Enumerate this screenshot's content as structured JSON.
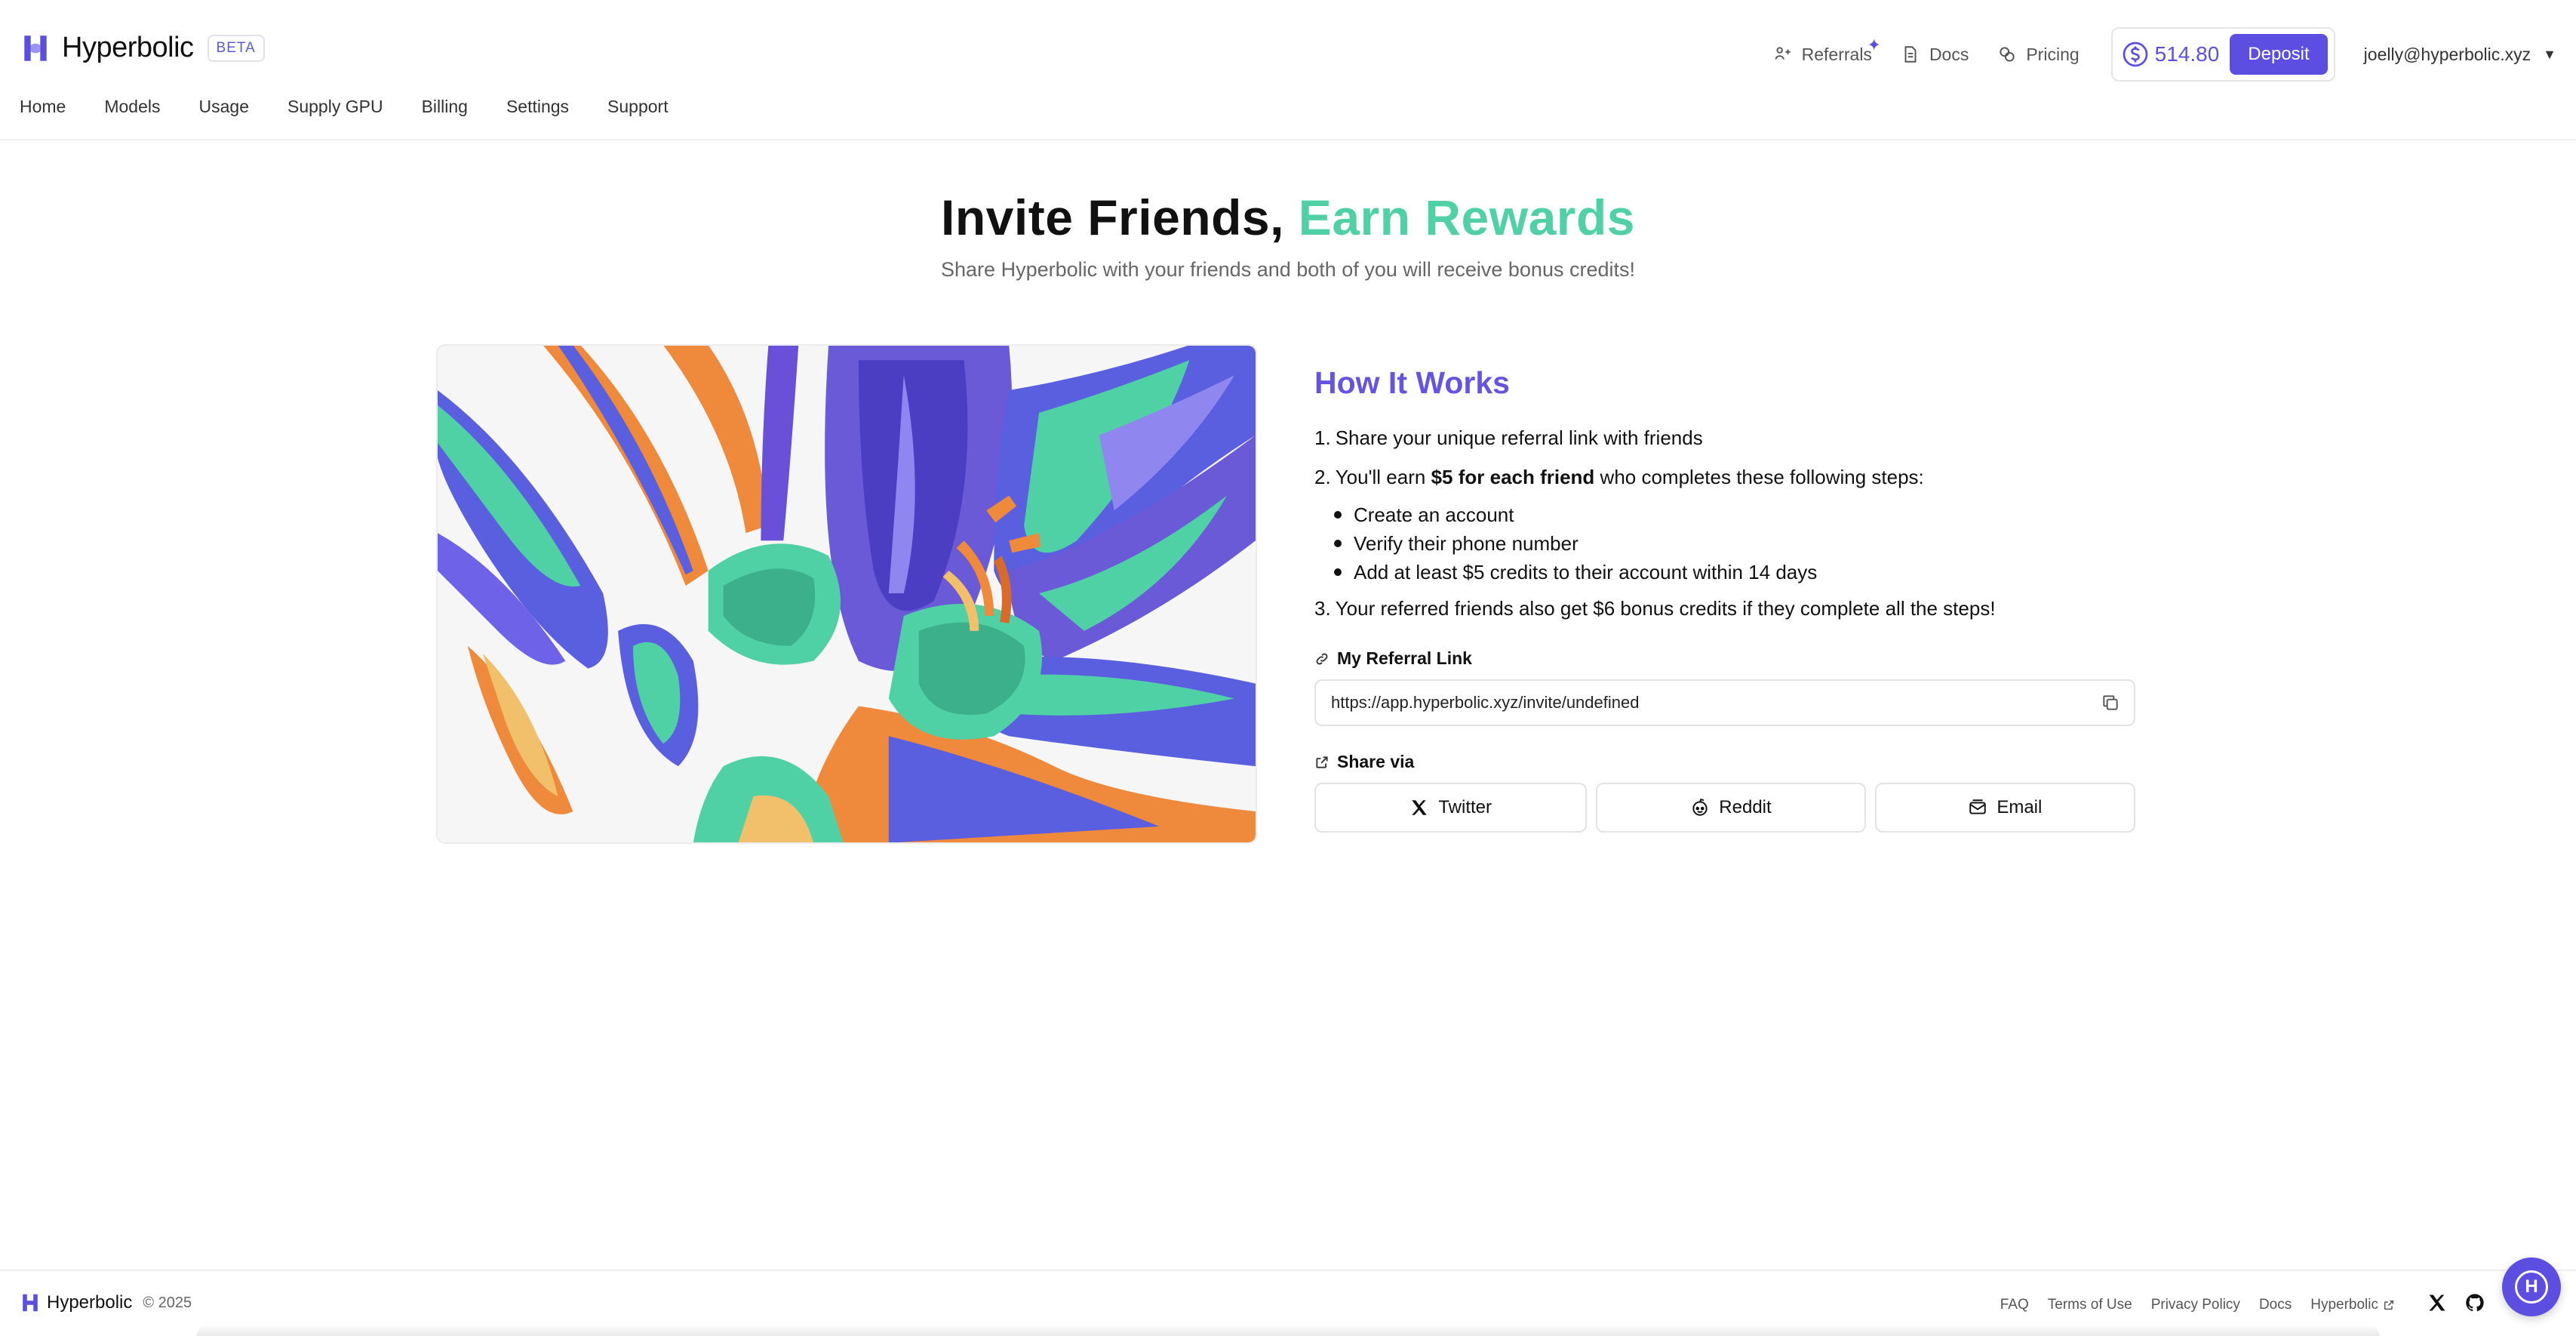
{
  "app": {
    "name": "Hyperbolic",
    "badge": "BETA",
    "logo_icon": "hyperbolic-logo-icon"
  },
  "topbar": {
    "links": [
      {
        "label": "Referrals",
        "icon": "referral-icon",
        "badge": "✦"
      },
      {
        "label": "Docs",
        "icon": "document-icon"
      },
      {
        "label": "Pricing",
        "icon": "coins-icon"
      }
    ],
    "balance": "514.80",
    "deposit_label": "Deposit",
    "user_email": "joelly@hyperbolic.xyz",
    "user_caret": "▼"
  },
  "nav": {
    "items": [
      "Home",
      "Models",
      "Usage",
      "Supply GPU",
      "Billing",
      "Settings",
      "Support"
    ]
  },
  "hero": {
    "title_main": "Invite Friends,",
    "title_accent": "Earn Rewards",
    "subtitle": "Share Hyperbolic with your friends and both of you will receive bonus credits!"
  },
  "how": {
    "title": "How It Works",
    "step1_num": "1.",
    "step1": "Share your unique referral link with friends",
    "step2_num": "2.",
    "step2_pre": "You'll earn",
    "step2_bold": "$5 for each friend",
    "step2_post": "who completes these following steps:",
    "bullets": [
      "Create an account",
      "Verify their phone number",
      "Add at least $5 credits to their account within 14 days"
    ],
    "step3_num": "3.",
    "step3": "Your referred friends also get $6 bonus credits if they complete all the steps!"
  },
  "referral": {
    "label": "My Referral Link",
    "link": "https://app.hyperbolic.xyz/invite/undefined",
    "share_label": "Share via",
    "share_buttons": [
      {
        "label": "Twitter",
        "icon": "x-logo-icon"
      },
      {
        "label": "Reddit",
        "icon": "reddit-icon"
      },
      {
        "label": "Email",
        "icon": "email-icon"
      }
    ]
  },
  "footer": {
    "brand": "Hyperbolic",
    "copyright": "© 2025",
    "links": [
      "FAQ",
      "Terms of Use",
      "Privacy Policy",
      "Docs",
      "Hyperbolic"
    ],
    "chat_letter": "H"
  },
  "colors": {
    "brand_purple": "#5b4ee0",
    "accent_mint": "#4fd1a5",
    "heading_purple": "#6554e0"
  }
}
